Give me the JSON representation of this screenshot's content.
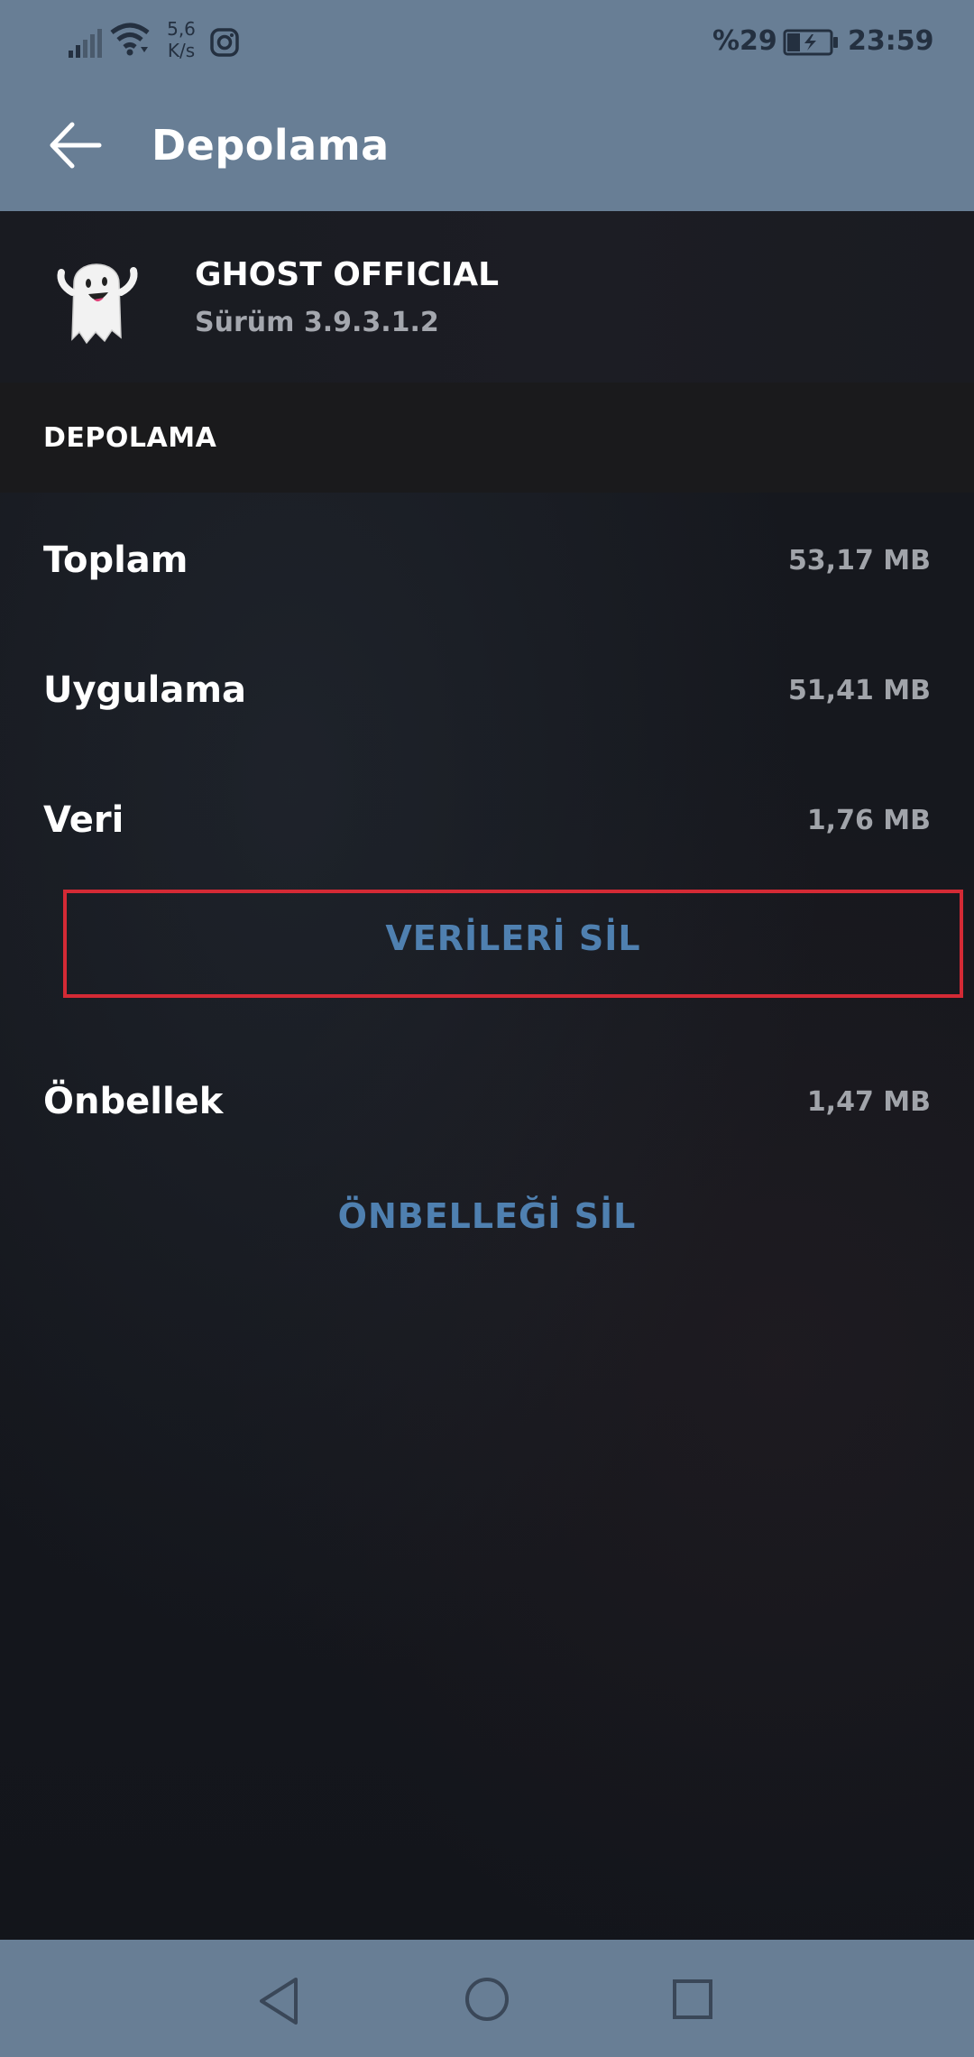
{
  "status_bar": {
    "speed_value": "5,6",
    "speed_unit": "K/s",
    "battery_percent": "%29",
    "time": "23:59"
  },
  "toolbar": {
    "title": "Depolama"
  },
  "app": {
    "name": "GHOST OFFICIAL",
    "version": "Sürüm 3.9.3.1.2"
  },
  "section": {
    "title": "DEPOLAMA"
  },
  "storage": {
    "rows": [
      {
        "label": "Toplam",
        "value": "53,17 MB"
      },
      {
        "label": "Uygulama",
        "value": "51,41 MB"
      },
      {
        "label": "Veri",
        "value": "1,76 MB"
      },
      {
        "label": "Önbellek",
        "value": "1,47 MB"
      }
    ],
    "clear_data_label": "VERİLERİ SİL",
    "clear_cache_label": "ÖNBELLEĞİ SİL"
  },
  "colors": {
    "bar": "#687e95",
    "accent": "#4f80b0",
    "highlight": "#d42a35"
  },
  "icons": {
    "back": "arrow-left-icon",
    "app": "ghost-icon",
    "nav_back": "triangle-back-icon",
    "nav_home": "circle-home-icon",
    "nav_recent": "square-recent-icon"
  }
}
